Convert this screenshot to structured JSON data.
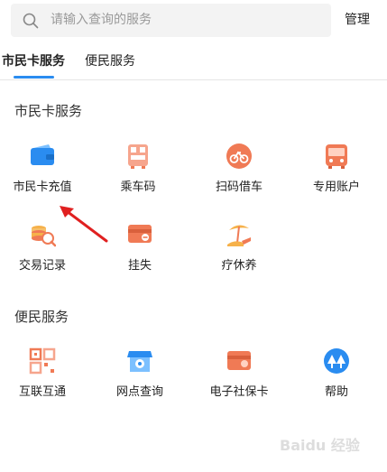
{
  "search": {
    "placeholder": "请输入查询的服务",
    "icon": "search-icon"
  },
  "header": {
    "manage_label": "管理"
  },
  "tabs": [
    {
      "label": "市民卡服务",
      "active": true
    },
    {
      "label": "便民服务",
      "active": false
    }
  ],
  "sections": [
    {
      "title": "市民卡服务",
      "items": [
        {
          "label": "市民卡充值",
          "icon": "wallet-icon"
        },
        {
          "label": "乘车码",
          "icon": "bus-qrcode-icon"
        },
        {
          "label": "扫码借车",
          "icon": "bicycle-icon"
        },
        {
          "label": "专用账户",
          "icon": "bus-icon"
        },
        {
          "label": "交易记录",
          "icon": "coin-search-icon"
        },
        {
          "label": "挂失",
          "icon": "card-lost-icon"
        },
        {
          "label": "疗休养",
          "icon": "beach-icon"
        }
      ]
    },
    {
      "title": "便民服务",
      "items": [
        {
          "label": "互联互通",
          "icon": "qrcode-icon"
        },
        {
          "label": "网点查询",
          "icon": "store-location-icon"
        },
        {
          "label": "电子社保卡",
          "icon": "social-card-icon"
        },
        {
          "label": "帮助",
          "icon": "tree-help-icon"
        }
      ]
    }
  ],
  "colors": {
    "accent": "#2a8cf0",
    "icon_orange": "#f07a55",
    "arrow_red": "#e02020"
  },
  "watermark": "Baidu 经验"
}
